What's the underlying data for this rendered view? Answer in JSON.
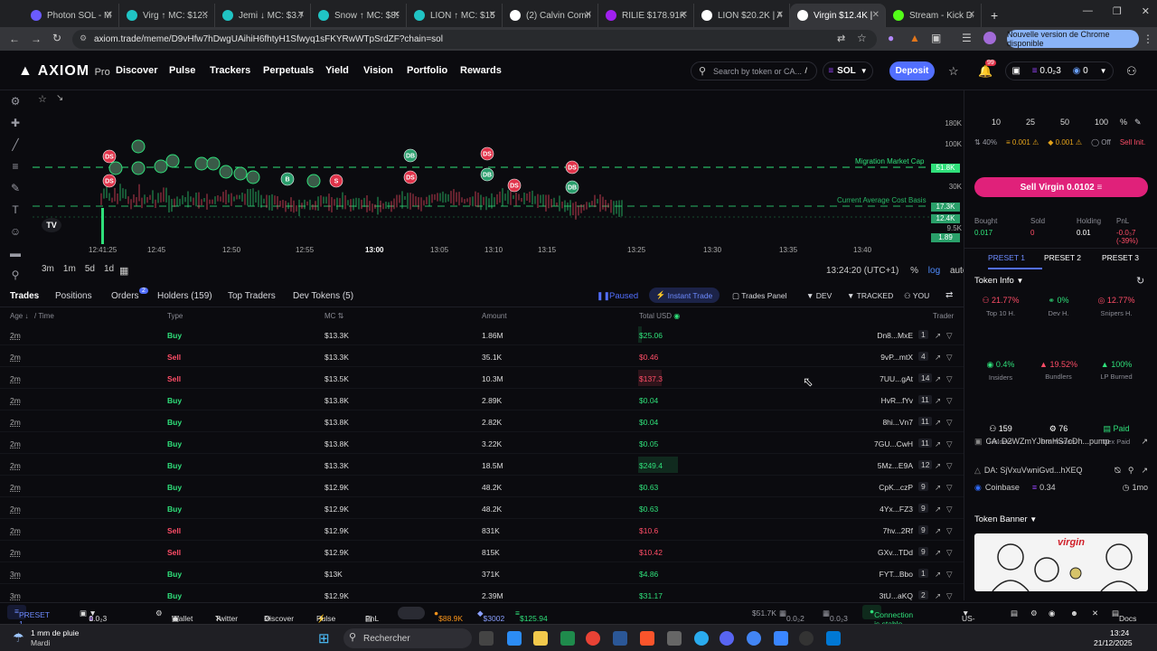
{
  "browser": {
    "tabs": [
      {
        "title": "Photon SOL - Me",
        "color": "#6b5bff"
      },
      {
        "title": "Virg ↑ MC: $12.30",
        "color": "#20c4c4"
      },
      {
        "title": "Jemi ↓ MC: $3.78K",
        "color": "#20c4c4"
      },
      {
        "title": "Snow ↑ MC: $89.5",
        "color": "#20c4c4"
      },
      {
        "title": "LION ↑ MC: $15.0",
        "color": "#20c4c4"
      },
      {
        "title": "(2) Calvin Comm",
        "color": "#ffffff"
      },
      {
        "title": "RILIE $178.91K -",
        "color": "#a020f0"
      },
      {
        "title": "LION $20.2K | A",
        "color": "#ffffff"
      },
      {
        "title": "Virgin $12.4K |",
        "color": "#ffffff"
      },
      {
        "title": "Stream - Kick Da",
        "color": "#53fc18"
      }
    ],
    "url": "axiom.trade/meme/D9vHfw7hDwgUAihiH6fhtyH1Sfwyq1sFKYRwWTpSrdZF?chain=sol",
    "update_label": "Nouvelle version de Chrome disponible"
  },
  "header": {
    "logo": "AXIOM",
    "logo_suffix": "Pro",
    "nav": [
      "Discover",
      "Pulse",
      "Trackers",
      "Perpetuals",
      "Yield",
      "Vision",
      "Portfolio",
      "Rewards"
    ],
    "search_placeholder": "Search by token or CA...",
    "search_shortcut": "/",
    "chain": "SOL",
    "deposit": "Deposit",
    "notif_count": "99",
    "wallet_sol": "0.0₂3",
    "wallet_count": "0"
  },
  "chart": {
    "timeframes": [
      "3m",
      "1m",
      "5d",
      "1d"
    ],
    "clock": "13:24:20 (UTC+1)",
    "pct": "%",
    "log": "log",
    "auto": "auto",
    "y_labels": [
      "180K",
      "100K",
      "30K",
      "9.5K"
    ],
    "tags": [
      {
        "v": "51.8K",
        "color": "#2fe07a"
      },
      {
        "v": "17.3K",
        "color": "#2aa06a"
      },
      {
        "v": "12.4K",
        "color": "#2aa06a"
      },
      {
        "v": "1.89",
        "color": "#2aa06a"
      }
    ],
    "x_labels": [
      "12:41:25",
      "12:45",
      "12:50",
      "12:55",
      "13:00",
      "13:05",
      "13:10",
      "13:15",
      "13:25",
      "13:30",
      "13:35",
      "13:40"
    ],
    "migration_label": "Migration Market Cap",
    "avg_label": "Current Average Cost Basis",
    "markers": [
      {
        "t": "DS",
        "c": "#e0334a"
      },
      {
        "t": "DB",
        "c": "#2a9d6c"
      },
      {
        "t": "DS",
        "c": "#e0334a"
      },
      {
        "t": "DB",
        "c": "#2a9d6c"
      },
      {
        "t": "DS",
        "c": "#e0334a"
      },
      {
        "t": "DS",
        "c": "#e0334a"
      },
      {
        "t": "DB",
        "c": "#2a9d6c"
      },
      {
        "t": "DS",
        "c": "#e0334a"
      },
      {
        "t": "DS",
        "c": "#e0334a"
      },
      {
        "t": "B",
        "c": "#2a9d6c"
      },
      {
        "t": "S",
        "c": "#e0334a"
      }
    ]
  },
  "trade_tabs": {
    "tabs": [
      "Trades",
      "Positions",
      "Orders",
      "Holders (159)",
      "Top Traders",
      "Dev Tokens (5)"
    ],
    "orders_badge": "2",
    "paused": "Paused",
    "instant": "Instant Trade",
    "panel": "Trades Panel",
    "dev": "DEV",
    "tracked": "TRACKED",
    "you": "YOU"
  },
  "table": {
    "headers": {
      "age": "Age",
      "time": "Time",
      "type": "Type",
      "mc": "MC",
      "amount": "Amount",
      "usd": "Total USD",
      "trader": "Trader"
    },
    "rows": [
      {
        "age": "2m",
        "type": "Buy",
        "mc": "$13.3K",
        "amount": "1.86M",
        "usd": "$25.06",
        "trader": "Dn8...MxE",
        "n": "1",
        "bar": 0.1
      },
      {
        "age": "2m",
        "type": "Sell",
        "mc": "$13.3K",
        "amount": "35.1K",
        "usd": "$0.46",
        "trader": "9vP...mtX",
        "n": "4",
        "bar": 0
      },
      {
        "age": "2m",
        "type": "Sell",
        "mc": "$13.5K",
        "amount": "10.3M",
        "usd": "$137.3",
        "trader": "7UU...gAt",
        "n": "14",
        "bar": 0.6
      },
      {
        "age": "2m",
        "type": "Buy",
        "mc": "$13.8K",
        "amount": "2.89K",
        "usd": "$0.04",
        "trader": "HvR...fYv",
        "n": "11",
        "bar": 0
      },
      {
        "age": "2m",
        "type": "Buy",
        "mc": "$13.8K",
        "amount": "2.82K",
        "usd": "$0.04",
        "trader": "8hi...Vn7",
        "n": "11",
        "bar": 0
      },
      {
        "age": "2m",
        "type": "Buy",
        "mc": "$13.8K",
        "amount": "3.22K",
        "usd": "$0.05",
        "trader": "7GU...CwH",
        "n": "11",
        "bar": 0
      },
      {
        "age": "2m",
        "type": "Buy",
        "mc": "$13.3K",
        "amount": "18.5M",
        "usd": "$249.4",
        "trader": "5Mz...E9A",
        "n": "12",
        "bar": 1
      },
      {
        "age": "2m",
        "type": "Buy",
        "mc": "$12.9K",
        "amount": "48.2K",
        "usd": "$0.63",
        "trader": "CpK...czP",
        "n": "9",
        "bar": 0
      },
      {
        "age": "2m",
        "type": "Buy",
        "mc": "$12.9K",
        "amount": "48.2K",
        "usd": "$0.63",
        "trader": "4Yx...FZ3",
        "n": "9",
        "bar": 0
      },
      {
        "age": "2m",
        "type": "Sell",
        "mc": "$12.9K",
        "amount": "831K",
        "usd": "$10.6",
        "trader": "7hv...2Rf",
        "n": "9",
        "bar": 0
      },
      {
        "age": "2m",
        "type": "Sell",
        "mc": "$12.9K",
        "amount": "815K",
        "usd": "$10.42",
        "trader": "GXv...TDd",
        "n": "9",
        "bar": 0
      },
      {
        "age": "3m",
        "type": "Buy",
        "mc": "$13K",
        "amount": "371K",
        "usd": "$4.86",
        "trader": "FYT...Bbo",
        "n": "1",
        "bar": 0
      },
      {
        "age": "3m",
        "type": "Buy",
        "mc": "$12.9K",
        "amount": "2.39M",
        "usd": "$31.17",
        "trader": "3tU...aKQ",
        "n": "2",
        "bar": 0
      }
    ]
  },
  "panel": {
    "amounts": [
      "10",
      "25",
      "50",
      "100",
      "%"
    ],
    "settings": {
      "slip": "40%",
      "a": "0.001",
      "b": "0.001",
      "off": "Off",
      "sell_init": "Sell Init."
    },
    "sell_button": "Sell Virgin 0.0102",
    "stats": [
      {
        "l": "Bought",
        "v": "0.017",
        "c": "#2fe07a"
      },
      {
        "l": "Sold",
        "v": "0",
        "c": "#ff4d67"
      },
      {
        "l": "Holding",
        "v": "0.01",
        "c": "#ffffff"
      },
      {
        "l": "PnL",
        "v": "-0.0₃7 (-39%)",
        "c": "#ff4d67"
      }
    ],
    "presets": [
      "PRESET 1",
      "PRESET 2",
      "PRESET 3"
    ],
    "token_info": "Token Info",
    "info": [
      {
        "v": "21.77%",
        "l": "Top 10 H.",
        "c": "#ff4d67"
      },
      {
        "v": "0%",
        "l": "Dev H.",
        "c": "#2fe07a"
      },
      {
        "v": "12.77%",
        "l": "Snipers H.",
        "c": "#ff4d67"
      },
      {
        "v": "0.4%",
        "l": "Insiders",
        "c": "#2fe07a"
      },
      {
        "v": "19.52%",
        "l": "Bundlers",
        "c": "#ff4d67"
      },
      {
        "v": "100%",
        "l": "LP Burned",
        "c": "#2fe07a"
      },
      {
        "v": "159",
        "l": "Holders",
        "c": "#ffffff"
      },
      {
        "v": "76",
        "l": "Pro Traders",
        "c": "#ffffff"
      },
      {
        "v": "Paid",
        "l": "Dex Paid",
        "c": "#2fe07a"
      }
    ],
    "ca": "CA: D2WZmYJbmHS7cDh...pump",
    "da": "DA: SjVxuVwniGvd...hXEQ",
    "coinbase": "Coinbase",
    "coinbase_v": "0.34",
    "coinbase_t": "1mo",
    "banner_title": "Token Banner",
    "banner_text": "virgin"
  },
  "bottom": {
    "preset": "PRESET 1",
    "wallets": "1",
    "sol": "0.0₂3",
    "items": [
      "Wallet",
      "Twitter",
      "Discover",
      "Pulse",
      "PnL"
    ],
    "btc": "$88.9K",
    "eth": "$3002",
    "sol_price": "$125.94",
    "m1": "$51.7K",
    "m2": "0.0₂2 7",
    "m3": "0.0₂3 6",
    "status": "Connection is stable",
    "region": "US-C",
    "docs": "Docs"
  },
  "taskbar": {
    "weather": "1 mm de pluie",
    "weather_sub": "Mardi",
    "search": "Rechercher",
    "time": "13:24",
    "date": "21/12/2025"
  }
}
